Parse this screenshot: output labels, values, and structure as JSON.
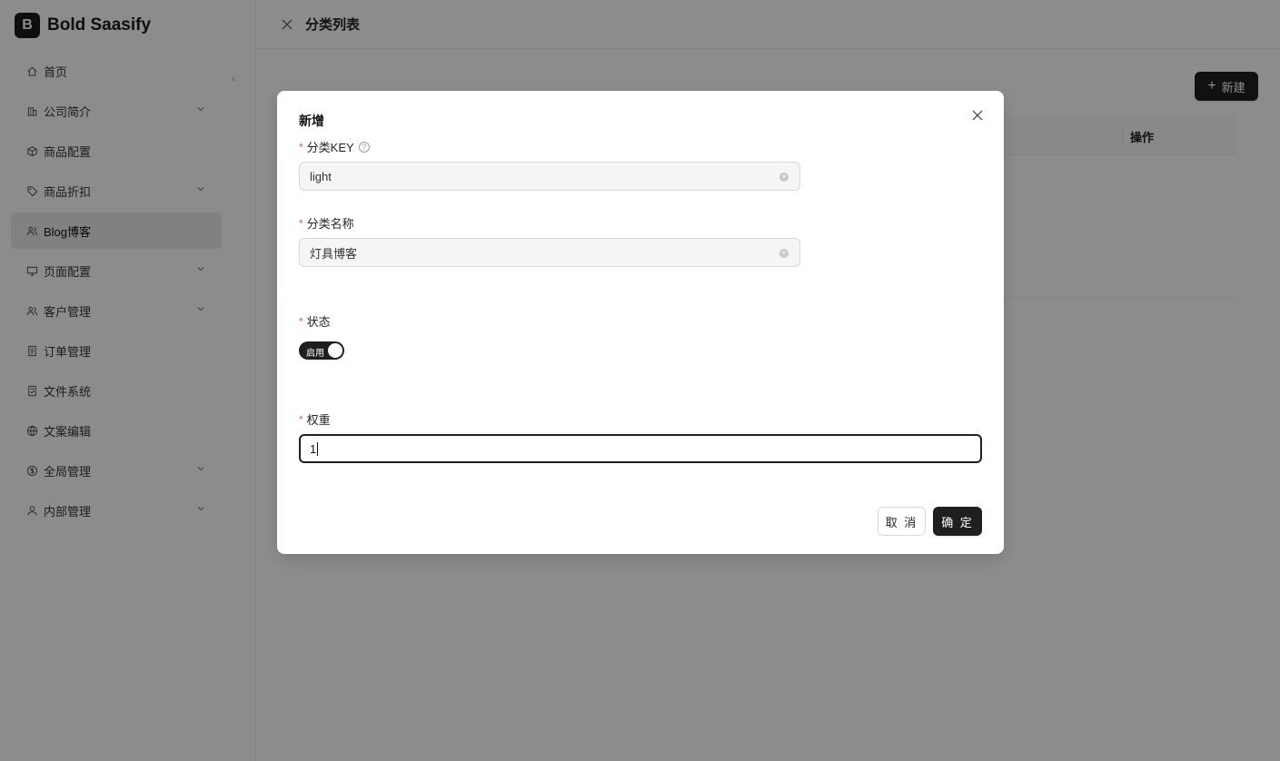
{
  "brand": {
    "logo_letter": "B",
    "name": "Bold Saasify"
  },
  "sidebar": {
    "collapse_glyph": "‹",
    "items": [
      {
        "label": "首页",
        "icon": "home-icon",
        "has_children": false,
        "active": false
      },
      {
        "label": "公司简介",
        "icon": "building-icon",
        "has_children": true,
        "active": false
      },
      {
        "label": "商品配置",
        "icon": "box-icon",
        "has_children": false,
        "active": false
      },
      {
        "label": "商品折扣",
        "icon": "tag-icon",
        "has_children": true,
        "active": false
      },
      {
        "label": "Blog博客",
        "icon": "users-icon",
        "has_children": false,
        "active": true
      },
      {
        "label": "页面配置",
        "icon": "monitor-icon",
        "has_children": true,
        "active": false
      },
      {
        "label": "客户管理",
        "icon": "users-icon",
        "has_children": true,
        "active": false
      },
      {
        "label": "订单管理",
        "icon": "file-list-icon",
        "has_children": false,
        "active": false
      },
      {
        "label": "文件系统",
        "icon": "file-check-icon",
        "has_children": false,
        "active": false
      },
      {
        "label": "文案编辑",
        "icon": "globe-icon",
        "has_children": false,
        "active": false
      },
      {
        "label": "全局管理",
        "icon": "dollar-circle-icon",
        "has_children": true,
        "active": false
      },
      {
        "label": "内部管理",
        "icon": "user-icon",
        "has_children": true,
        "active": false
      }
    ]
  },
  "header": {
    "title": "分类列表"
  },
  "toolbar": {
    "new_label": "新建",
    "new_icon": "plus-icon"
  },
  "table": {
    "columns": {
      "ops": "操作"
    }
  },
  "modal": {
    "title": "新增",
    "fields": {
      "key": {
        "label": "分类KEY",
        "value": "light",
        "required": true,
        "has_help": true
      },
      "name": {
        "label": "分类名称",
        "value": "灯具博客",
        "required": true
      },
      "status": {
        "label": "状态",
        "switch_label": "启用",
        "checked": true,
        "required": true
      },
      "weight": {
        "label": "权重",
        "value": "1",
        "required": true
      }
    },
    "cancel_label": "取 消",
    "ok_label": "确 定"
  },
  "colors": {
    "primary": "#1f1f1f",
    "required": "#ff4d4f",
    "overlay": "rgba(0,0,0,0.45)"
  }
}
